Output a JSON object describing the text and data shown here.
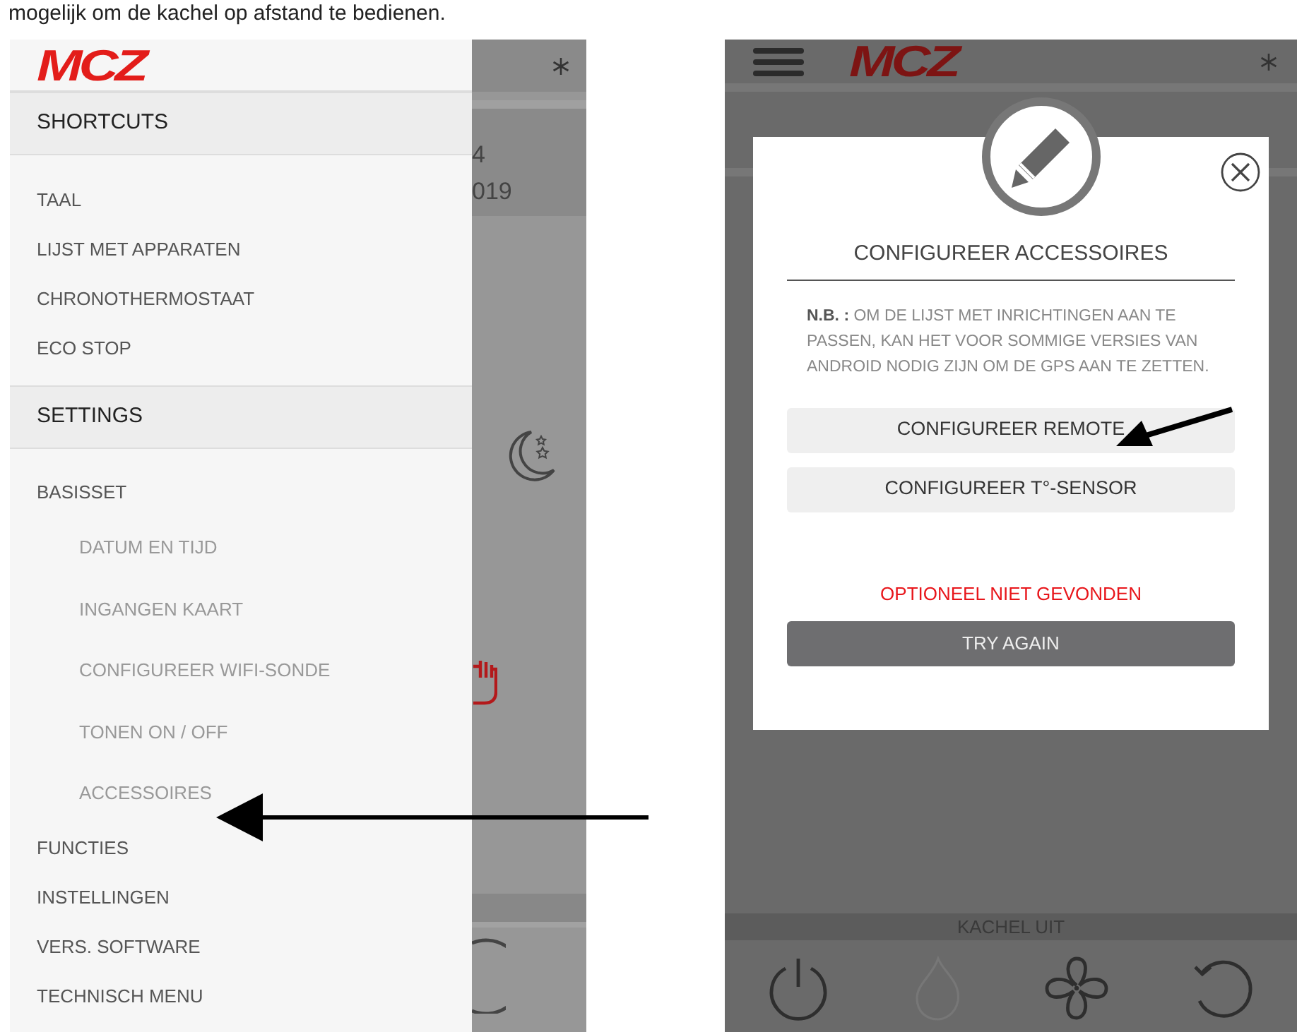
{
  "caption": "mogelijk om de kachel op afstand te bedienen.",
  "left_screen": {
    "logo": "MCZ",
    "background_texts": [
      "4",
      "019"
    ],
    "drawer": {
      "sections": [
        {
          "title": "SHORTCUTS",
          "items": [
            {
              "label": "TAAL"
            },
            {
              "label": "LIJST MET APPARATEN"
            },
            {
              "label": "CHRONOTHERMOSTAAT"
            },
            {
              "label": "ECO STOP"
            }
          ]
        },
        {
          "title": "SETTINGS",
          "items": [
            {
              "label": "BASISSET",
              "children": [
                {
                  "label": "DATUM EN TIJD"
                },
                {
                  "label": "INGANGEN KAART"
                },
                {
                  "label": "CONFIGUREER WIFI-SONDE"
                },
                {
                  "label": "TONEN ON / OFF"
                },
                {
                  "label": "ACCESSOIRES"
                }
              ]
            },
            {
              "label": "FUNCTIES"
            },
            {
              "label": "INSTELLINGEN"
            },
            {
              "label": "VERS. SOFTWARE"
            },
            {
              "label": "TECHNISCH MENU"
            }
          ]
        }
      ]
    }
  },
  "right_screen": {
    "logo": "MCZ",
    "dialog": {
      "title": "CONFIGUREER ACCESSOIRES",
      "note": "**N.B. :** OM DE LIJST MET INRICHTINGEN AAN TE PASSEN, KAN HET VOOR SOMMIGE VERSIES VAN ANDROID NODIG ZIJN OM DE GPS AAN TE ZETTEN.",
      "buttons": [
        {
          "label": "CONFIGUREER REMOTE",
          "kind": "light"
        },
        {
          "label": "CONFIGUREER T°-SENSOR",
          "kind": "light"
        }
      ],
      "error": "OPTIONEEL NIET GEVONDEN",
      "retry": {
        "label": "TRY AGAIN",
        "kind": "dark"
      }
    },
    "status": "KACHEL UIT"
  }
}
